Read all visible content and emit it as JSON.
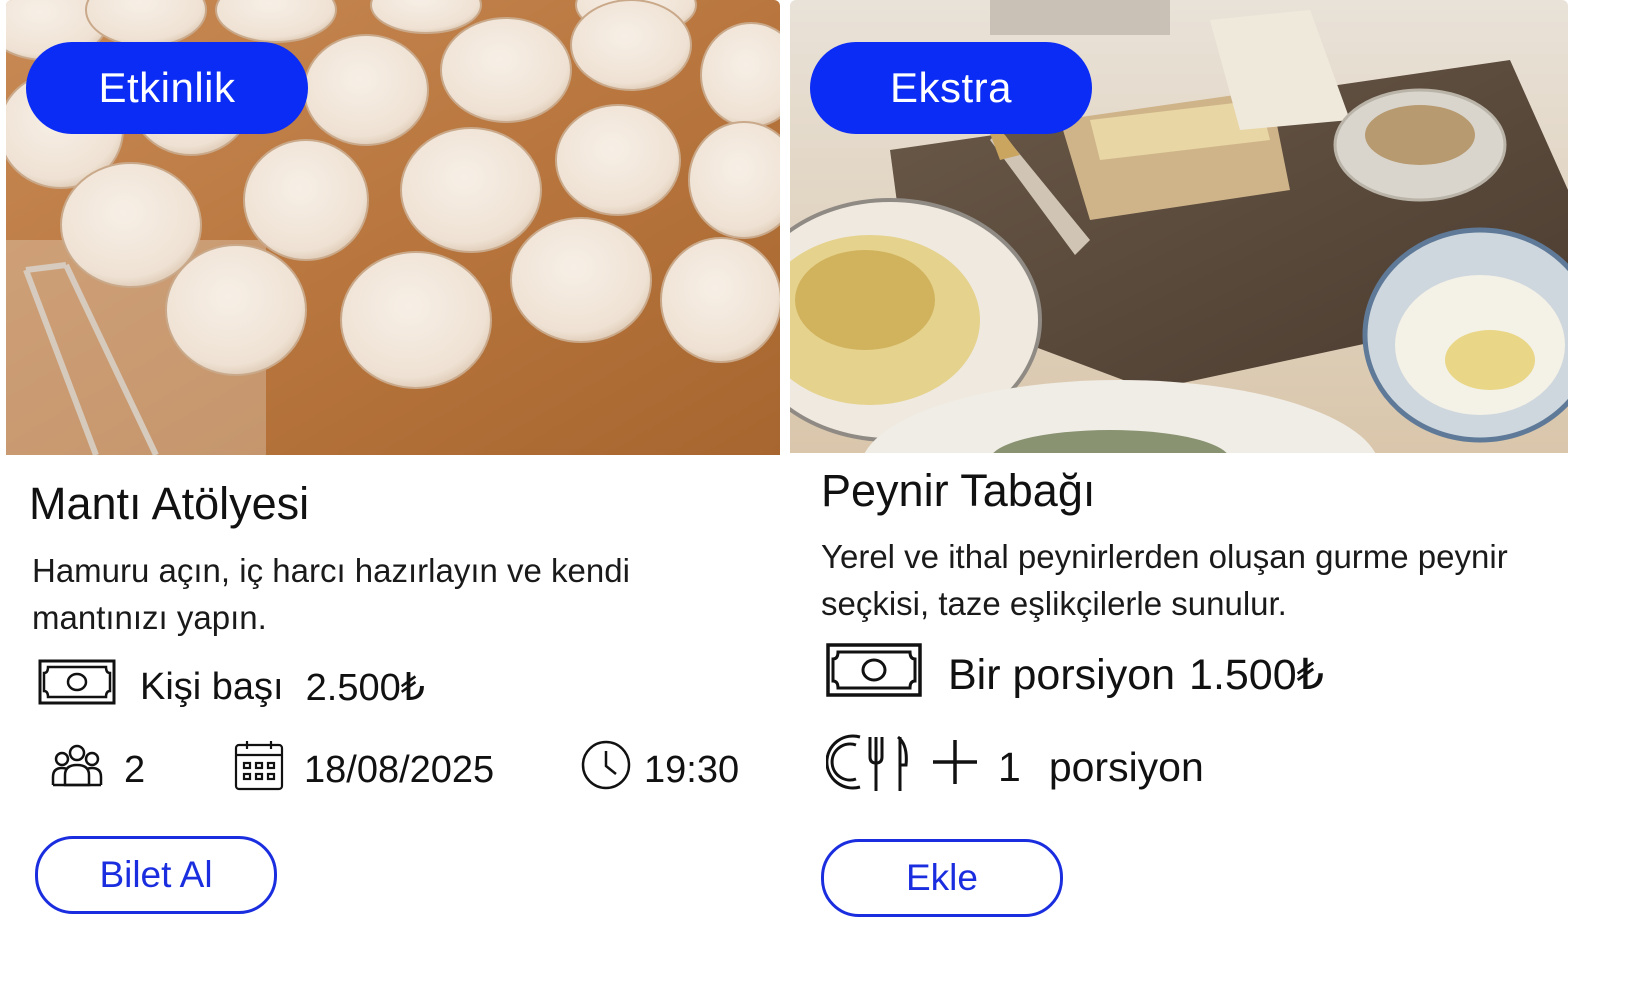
{
  "cards": [
    {
      "badge": "Etkinlik",
      "title": "Mantı Atölyesi",
      "description": "Hamuru açın, iç harcı hazırlayın ve kendi mantınızı yapın.",
      "price_label": "Kişi başı",
      "price": "2.500₺",
      "people": "2",
      "date": "18/08/2025",
      "time": "19:30",
      "button_label": "Bilet Al"
    },
    {
      "badge": "Ekstra",
      "title": "Peynir Tabağı",
      "description": "Yerel ve ithal peynirlerden oluşan gurme peynir seçkisi, taze eşlikçilerle sunulur.",
      "price_label": "Bir porsiyon",
      "price": "1.500₺",
      "portion_count": "1",
      "portion_unit": "porsiyon",
      "button_label": "Ekle"
    }
  ],
  "icons": {
    "money": "money-icon",
    "people": "people-icon",
    "calendar": "calendar-icon",
    "clock": "clock-icon",
    "dining": "dining-icon",
    "plus": "plus-icon"
  },
  "colors": {
    "badge_bg": "#0a2cf5",
    "button_border": "#1a2ee0",
    "text": "#111111"
  }
}
